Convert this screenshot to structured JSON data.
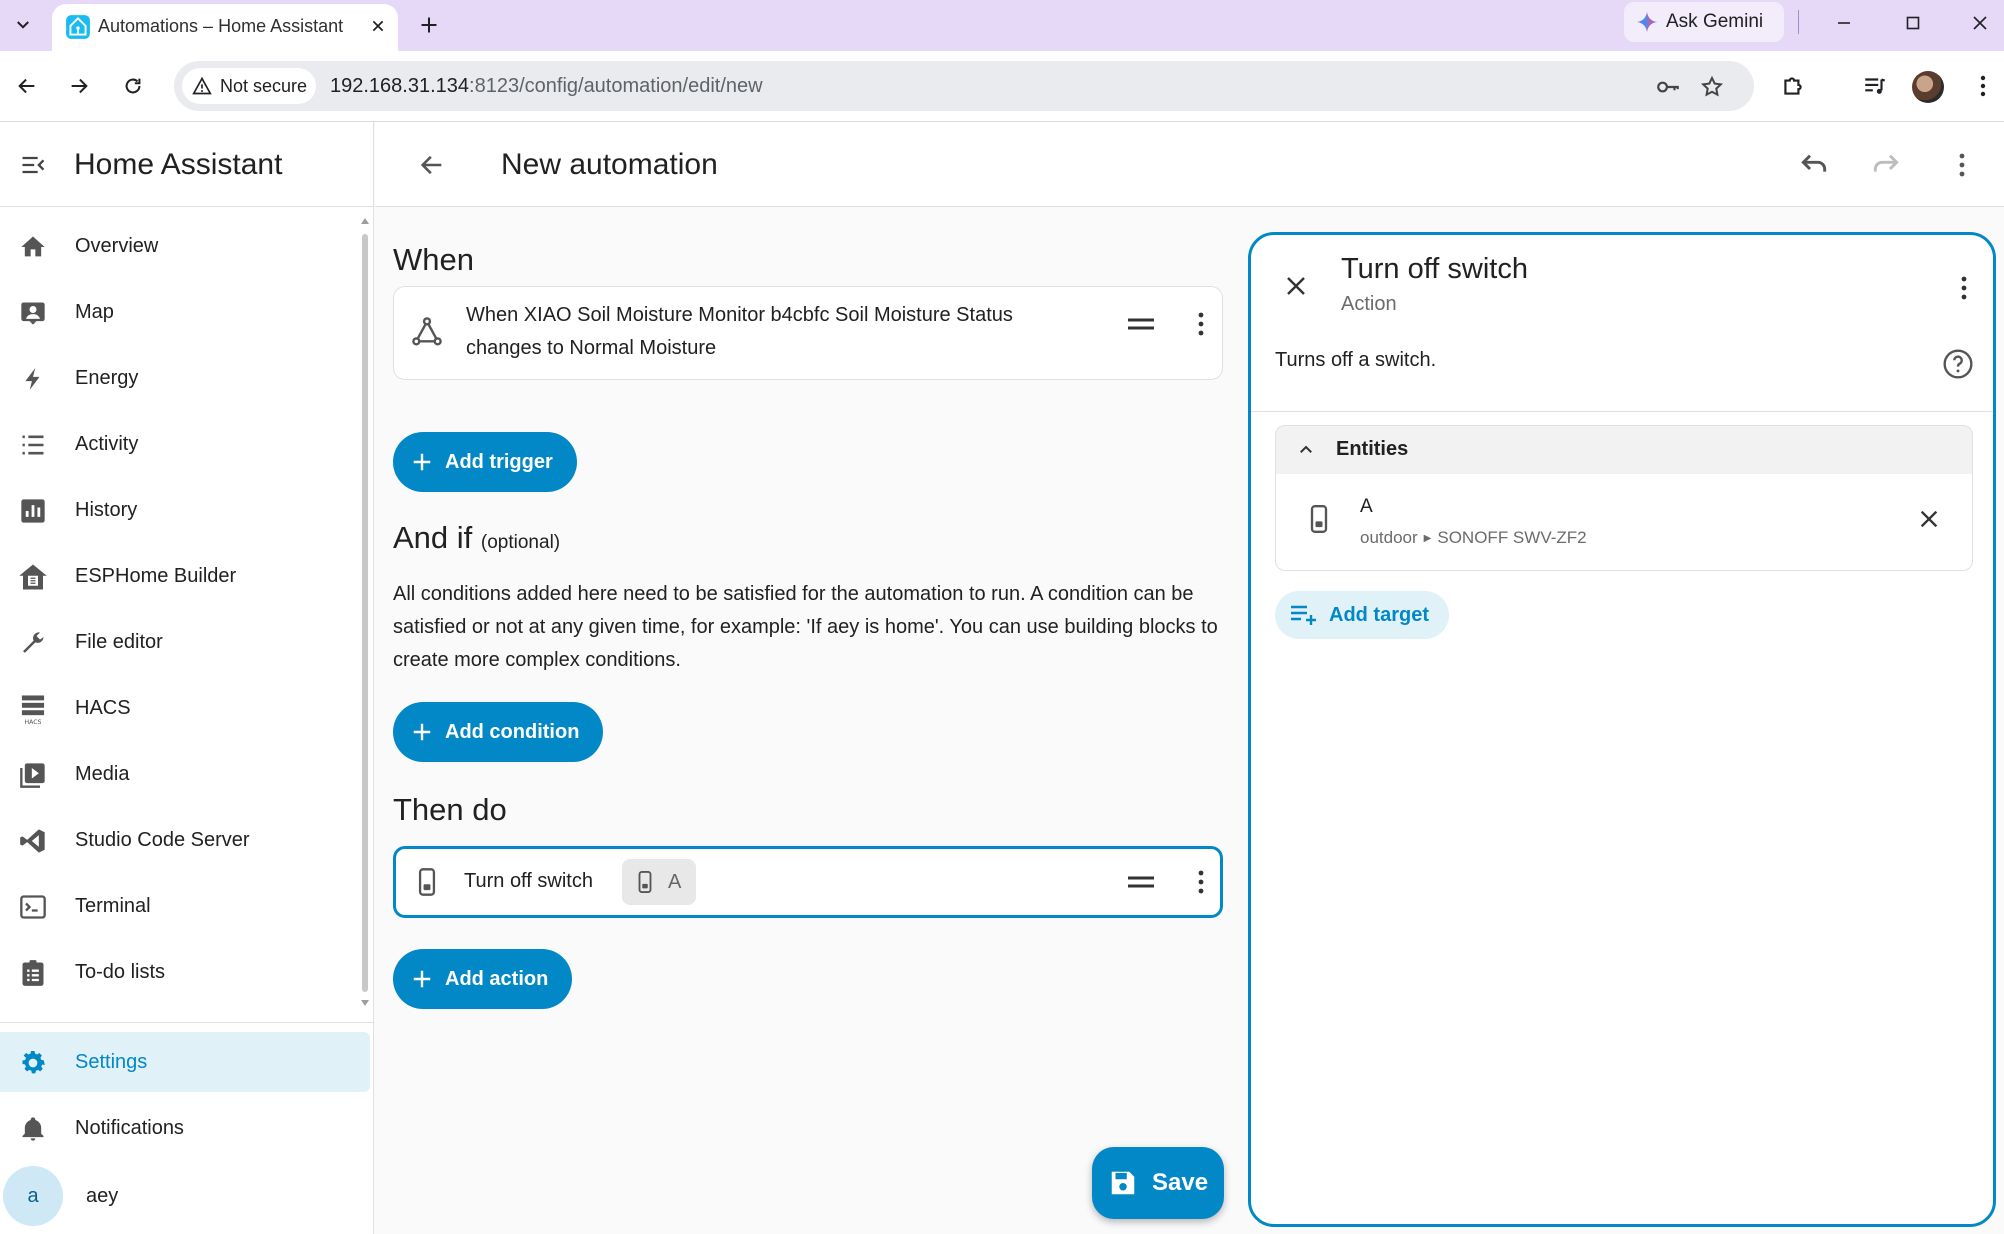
{
  "browser": {
    "tab_title": "Automations – Home Assistant",
    "ask_gemini": "Ask Gemini",
    "security_chip": "Not secure",
    "url_host": "192.168.31.134",
    "url_rest": ":8123/config/automation/edit/new"
  },
  "sidebar": {
    "title": "Home Assistant",
    "items": [
      {
        "label": "Overview",
        "icon": "home-icon"
      },
      {
        "label": "Map",
        "icon": "map-person-icon"
      },
      {
        "label": "Energy",
        "icon": "lightning-icon"
      },
      {
        "label": "Activity",
        "icon": "list-icon"
      },
      {
        "label": "History",
        "icon": "chart-bar-icon"
      },
      {
        "label": "ESPHome Builder",
        "icon": "esphome-icon"
      },
      {
        "label": "File editor",
        "icon": "wrench-icon"
      },
      {
        "label": "HACS",
        "icon": "hacs-icon"
      },
      {
        "label": "Media",
        "icon": "media-icon"
      },
      {
        "label": "Studio Code Server",
        "icon": "vscode-icon"
      },
      {
        "label": "Terminal",
        "icon": "terminal-icon"
      },
      {
        "label": "To-do lists",
        "icon": "clipboard-list-icon"
      }
    ],
    "settings": "Settings",
    "notifications": "Notifications",
    "user_initial": "a",
    "user_name": "aey"
  },
  "header": {
    "title": "New automation"
  },
  "editor": {
    "when": {
      "title": "When",
      "trigger_text": "When XIAO Soil Moisture Monitor b4cbfc Soil Moisture Status changes to Normal Moisture",
      "add_button": "Add trigger"
    },
    "and_if": {
      "title": "And if",
      "optional": "(optional)",
      "description": "All conditions added here need to be satisfied for the automation to run. A condition can be satisfied or not at any given time, for example: 'If aey is home'. You can use building blocks to create more complex conditions.",
      "add_button": "Add condition"
    },
    "then_do": {
      "title": "Then do",
      "action_text": "Turn off switch",
      "action_chip": "A",
      "add_button": "Add action"
    },
    "save": "Save"
  },
  "panel": {
    "title": "Turn off switch",
    "subtitle": "Action",
    "description": "Turns off a switch.",
    "entities_label": "Entities",
    "entity": {
      "name": "A",
      "area": "outdoor",
      "device": "SONOFF SWV-ZF2"
    },
    "add_target": "Add target"
  },
  "colors": {
    "accent": "#0288c7",
    "tabbar": "#e6d9f7",
    "sidebar_active_bg": "#e1f1f8"
  }
}
